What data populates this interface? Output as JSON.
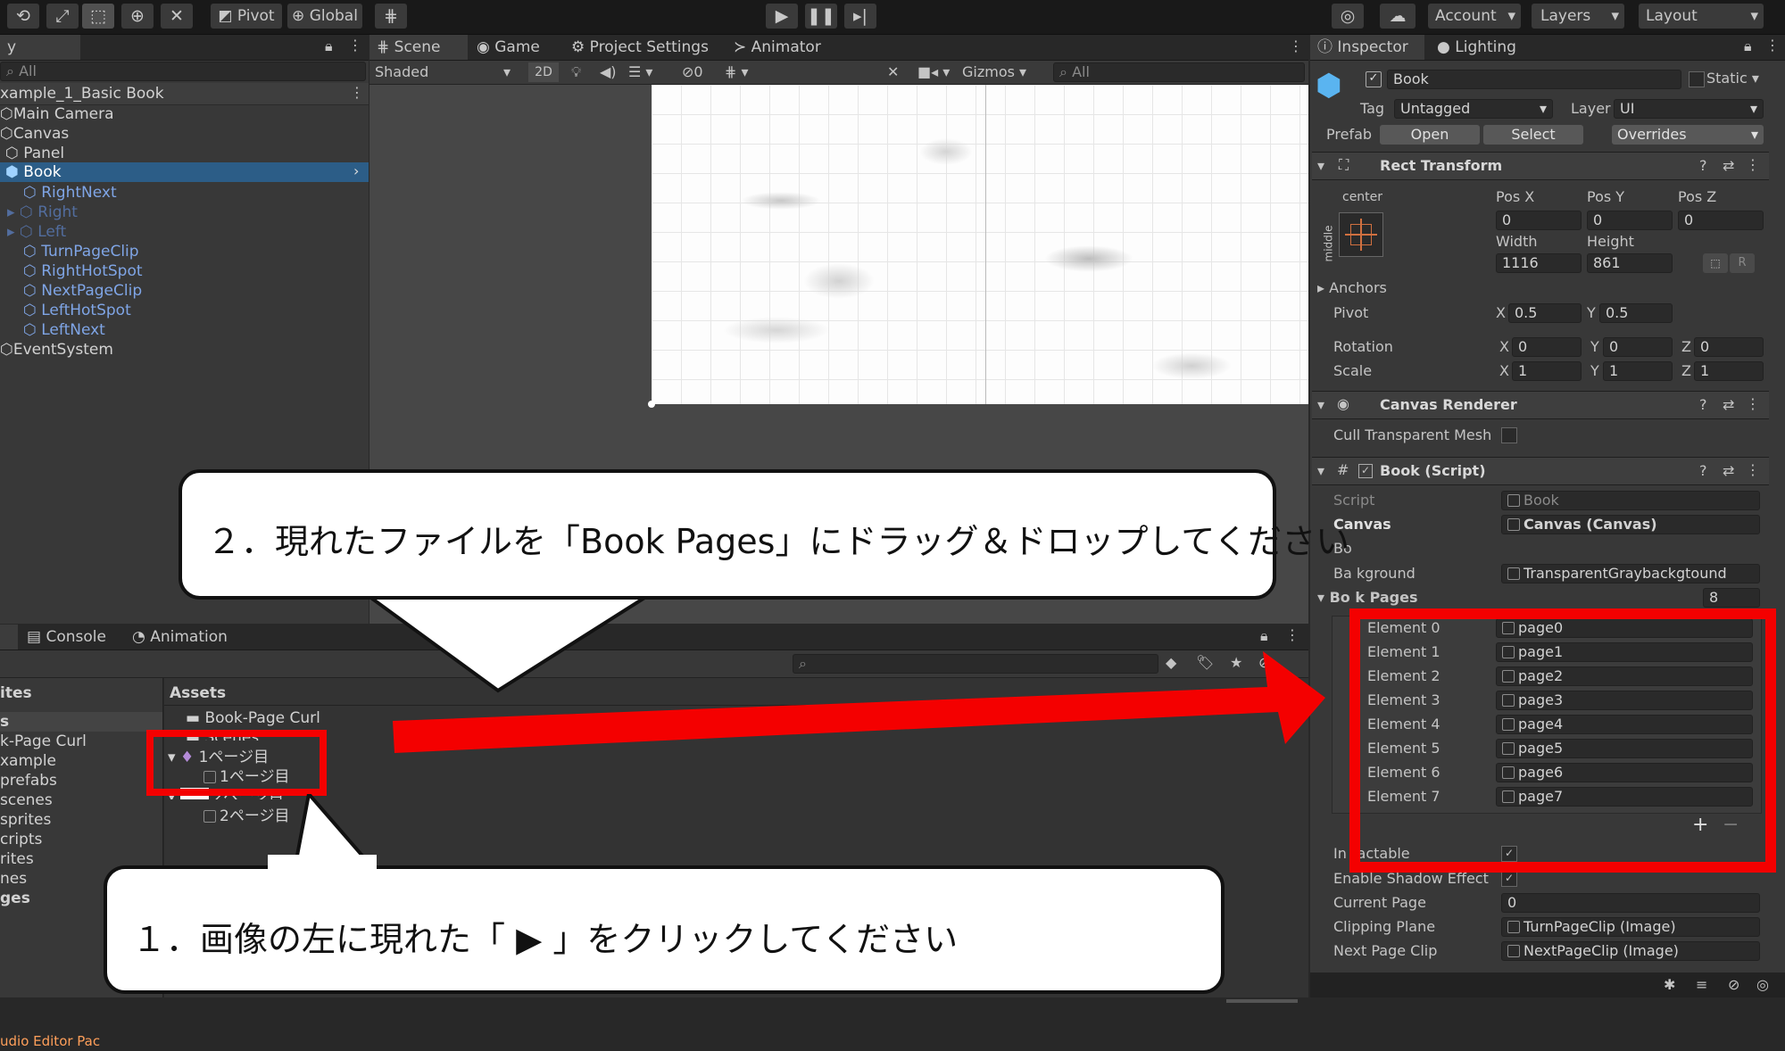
{
  "toolbar": {
    "pivot": "Pivot",
    "global": "Global",
    "account": "Account",
    "layers": "Layers",
    "layout": "Layout"
  },
  "hierarchy": {
    "tab_title": "y",
    "search_placeholder": "All",
    "scene_name": "xample_1_Basic Book",
    "items": [
      {
        "label": "Main Camera"
      },
      {
        "label": "Canvas"
      },
      {
        "label": "Panel"
      },
      {
        "label": "Book"
      },
      {
        "label": "RightNext"
      },
      {
        "label": "Right"
      },
      {
        "label": "Left"
      },
      {
        "label": "TurnPageClip"
      },
      {
        "label": "RightHotSpot"
      },
      {
        "label": "NextPageClip"
      },
      {
        "label": "LeftHotSpot"
      },
      {
        "label": "LeftNext"
      },
      {
        "label": "EventSystem"
      }
    ]
  },
  "scene": {
    "tabs": [
      "Scene",
      "Game",
      "Project Settings",
      "Animator"
    ],
    "shading": "Shaded",
    "mode_2d": "2D",
    "hidden_count": "0",
    "gizmos": "Gizmos",
    "search_placeholder": "All"
  },
  "bottom": {
    "tabs": [
      "Console",
      "Animation"
    ],
    "left_header": "ites",
    "left_items": [
      "s",
      "k-Page Curl",
      "xample",
      " prefabs",
      " scenes",
      " sprites",
      "cripts",
      "rites",
      "nes",
      "ges"
    ],
    "bottom_status": "udio Editor Pac",
    "assets_header": "Assets",
    "assets": [
      {
        "label": "Book-Page Curl"
      },
      {
        "label": "Scenes"
      },
      {
        "label": "1ページ目"
      },
      {
        "label": "1ページ目"
      },
      {
        "label": "2ページ目"
      },
      {
        "label": "2ページ目"
      }
    ]
  },
  "inspector": {
    "tabs": [
      "Inspector",
      "Lighting"
    ],
    "object_name": "Book",
    "static_label": "Static",
    "tag_label": "Tag",
    "tag_value": "Untagged",
    "layer_label": "Layer",
    "layer_value": "UI",
    "prefab_label": "Prefab",
    "prefab_open": "Open",
    "prefab_select": "Select",
    "prefab_overrides": "Overrides",
    "rect_transform": {
      "title": "Rect Transform",
      "anchor_h": "center",
      "anchor_v": "middle",
      "pos_x_label": "Pos X",
      "pos_y_label": "Pos Y",
      "pos_z_label": "Pos Z",
      "pos_x": "0",
      "pos_y": "0",
      "pos_z": "0",
      "width_label": "Width",
      "height_label": "Height",
      "width": "1116",
      "height": "861",
      "r_button": "R",
      "anchors_label": "Anchors",
      "pivot_label": "Pivot",
      "pivot_x": "0.5",
      "pivot_y": "0.5",
      "rotation_label": "Rotation",
      "rot_x": "0",
      "rot_y": "0",
      "rot_z": "0",
      "scale_label": "Scale",
      "scale_x": "1",
      "scale_y": "1",
      "scale_z": "1",
      "x": "X",
      "y": "Y",
      "z": "Z"
    },
    "canvas_renderer": {
      "title": "Canvas Renderer",
      "cull_label": "Cull Transparent Mesh"
    },
    "book_script": {
      "title": "Book (Script)",
      "script_label": "Script",
      "script_value": "Book",
      "canvas_label": "Canvas",
      "canvas_value": "Canvas (Canvas)",
      "b_label": "Bo",
      "background_label": "Ba  kground",
      "background_value": "TransparentGraybackgtound",
      "book_pages_label": "Bo  k Pages",
      "book_pages_count": "8",
      "elements": [
        {
          "label": "Element 0",
          "value": "page0"
        },
        {
          "label": "Element 1",
          "value": "page1"
        },
        {
          "label": "Element 2",
          "value": "page2"
        },
        {
          "label": "Element 3",
          "value": "page3"
        },
        {
          "label": "Element 4",
          "value": "page4"
        },
        {
          "label": "Element 5",
          "value": "page5"
        },
        {
          "label": "Element 6",
          "value": "page6"
        },
        {
          "label": "Element 7",
          "value": "page7"
        }
      ],
      "interactable_label": "In   ractable",
      "shadow_label": "Enable Shadow Effect",
      "current_page_label": "Current Page",
      "current_page_value": "0",
      "clipping_label": "Clipping Plane",
      "clipping_value": "TurnPageClip (Image)",
      "next_clip_label": "Next Page Clip",
      "next_clip_value": "NextPageClip (Image)"
    }
  },
  "callouts": {
    "step2": "２．現れたファイルを「Book Pages」にドラッグ＆ドロップしてください",
    "step1": "１．画像の左に現れた「 ▶ 」をクリックしてください"
  },
  "colors": {
    "highlight": "#f40000",
    "selection": "#2c5d87"
  }
}
